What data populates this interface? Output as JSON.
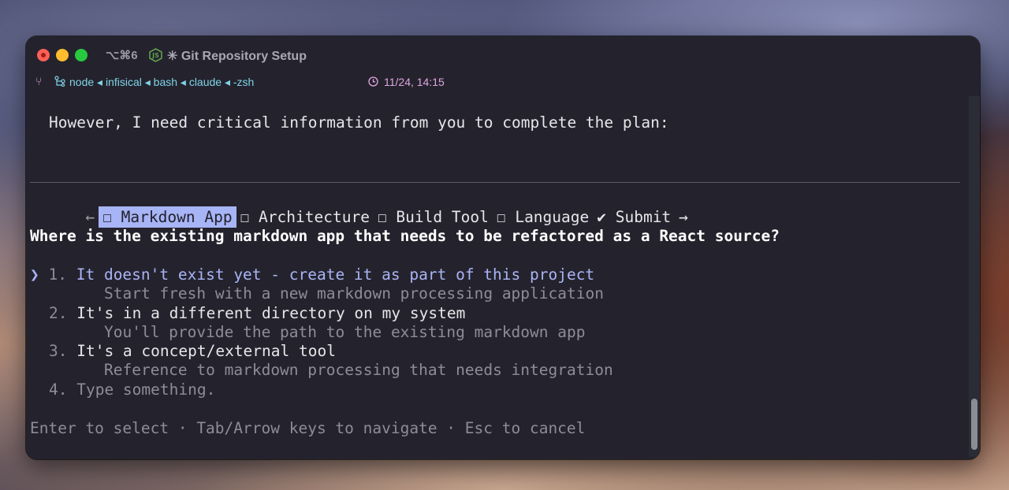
{
  "window": {
    "shortcut": "⌥⌘6",
    "title": "✳ Git Repository Setup"
  },
  "infobar": {
    "process_chain": "node ◂ infisical ◂ bash ◂ claude ◂ -zsh",
    "datetime": "11/24, 14:15"
  },
  "terminal": {
    "intro": "However, I need critical information from you to complete the plan:",
    "nav_left": "←",
    "nav_right": "→",
    "tabs": [
      {
        "label": "☐ Markdown App",
        "active": true
      },
      {
        "label": "☐ Architecture",
        "active": false
      },
      {
        "label": "☐ Build Tool",
        "active": false
      },
      {
        "label": "☐ Language",
        "active": false
      },
      {
        "label": "✔ Submit",
        "active": false
      }
    ],
    "question": "Where is the existing markdown app that needs to be refactored as a React source?",
    "cursor": "❯",
    "options": [
      {
        "number": "1.",
        "label": "It doesn't exist yet - create it as part of this project",
        "description": "Start fresh with a new markdown processing application"
      },
      {
        "number": "2.",
        "label": "It's in a different directory on my system",
        "description": "You'll provide the path to the existing markdown app"
      },
      {
        "number": "3.",
        "label": "It's a concept/external tool",
        "description": "Reference to markdown processing that needs integration"
      },
      {
        "number": "4.",
        "label": "Type something.",
        "description": ""
      }
    ],
    "footer": "Enter to select · Tab/Arrow keys to navigate · Esc to cancel"
  },
  "colors": {
    "accent_tab": "#a7b4f5",
    "selected_option": "#aab4f5",
    "process_text": "#7fd3e6",
    "datetime_text": "#e0a6e0"
  }
}
